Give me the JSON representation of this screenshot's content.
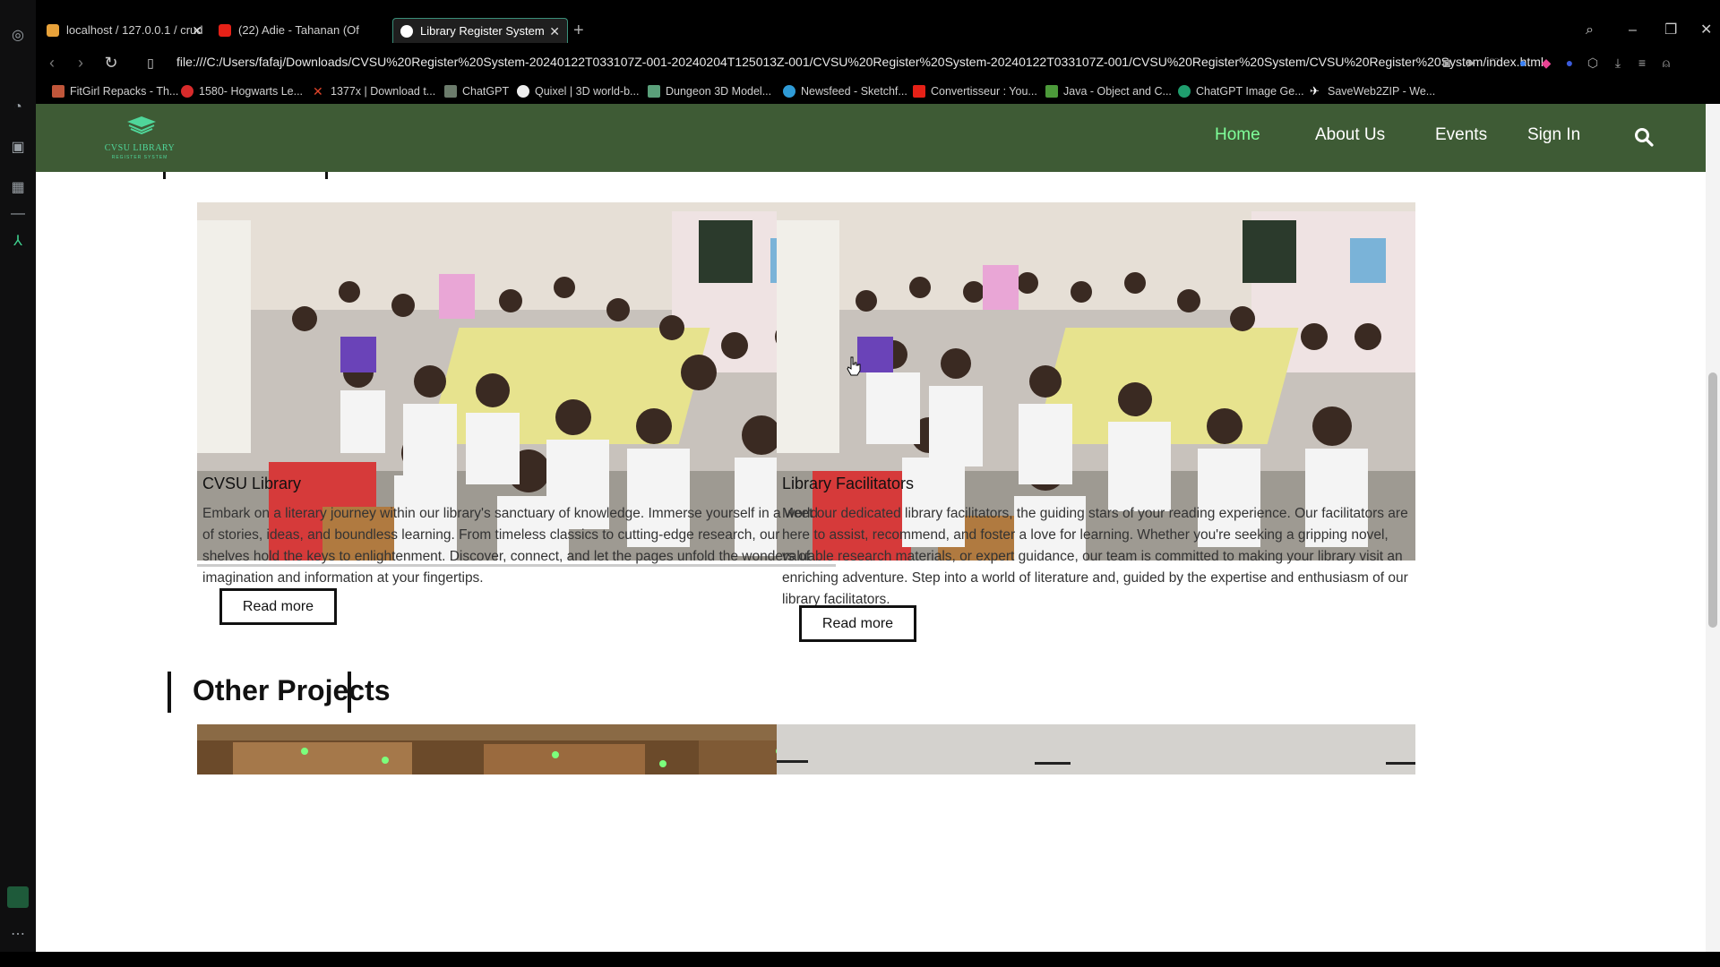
{
  "browser": {
    "tabs": [
      {
        "title": "localhost / 127.0.0.1 / crud"
      },
      {
        "title": "(22) Adie - Tahanan (Of"
      },
      {
        "title": "Library Register System"
      }
    ],
    "url": "file:///C:/Users/fafaj/Downloads/CVSU%20Register%20System-20240122T033107Z-001-20240204T125013Z-001/CVSU%20Register%20System-20240122T033107Z-001/CVSU%20Register%20System/CVSU%20Register%20System/index.html",
    "bookmarks": [
      {
        "label": "FitGirl Repacks - Th..."
      },
      {
        "label": "1580- Hogwarts Le..."
      },
      {
        "label": "1377x | Download t..."
      },
      {
        "label": "ChatGPT"
      },
      {
        "label": "Quixel | 3D world-b..."
      },
      {
        "label": "Dungeon 3D Model..."
      },
      {
        "label": "Newsfeed - Sketchf..."
      },
      {
        "label": "Convertisseur : You..."
      },
      {
        "label": "Java - Object and C..."
      },
      {
        "label": "ChatGPT Image Ge..."
      },
      {
        "label": "SaveWeb2ZIP - We..."
      }
    ]
  },
  "site": {
    "logo": {
      "text": "CVSU LIBRARY",
      "sub": "REGISTER SYSTEM"
    },
    "nav": [
      {
        "label": "Home",
        "active": true
      },
      {
        "label": "About Us"
      },
      {
        "label": "Events"
      },
      {
        "label": "Sign In"
      }
    ],
    "cards": [
      {
        "title": "CVSU Library",
        "text": "Embark on a literary journey within our library's sanctuary of knowledge. Immerse yourself in a world of stories, ideas, and boundless learning. From timeless classics to cutting-edge research, our shelves hold the keys to enlightenment. Discover, connect, and let the pages unfold the wonders of imagination and information at your fingertips.",
        "button": "Read more"
      },
      {
        "title": "Library Facilitators",
        "text": "Meet our dedicated library facilitators, the guiding stars of your reading experience. Our facilitators are here to assist, recommend, and foster a love for learning. Whether you're seeking a gripping novel, valuable research materials, or expert guidance, our team is committed to making your library visit an enriching adventure. Step into a world of literature and, guided by the expertise and enthusiasm of our library facilitators.",
        "button": "Read more"
      }
    ],
    "other_projects": {
      "heading": "Other Projects"
    }
  },
  "colors": {
    "nav_bg": "#3e5b35",
    "nav_active": "#7fff9a",
    "logo": "#4fd69a"
  }
}
